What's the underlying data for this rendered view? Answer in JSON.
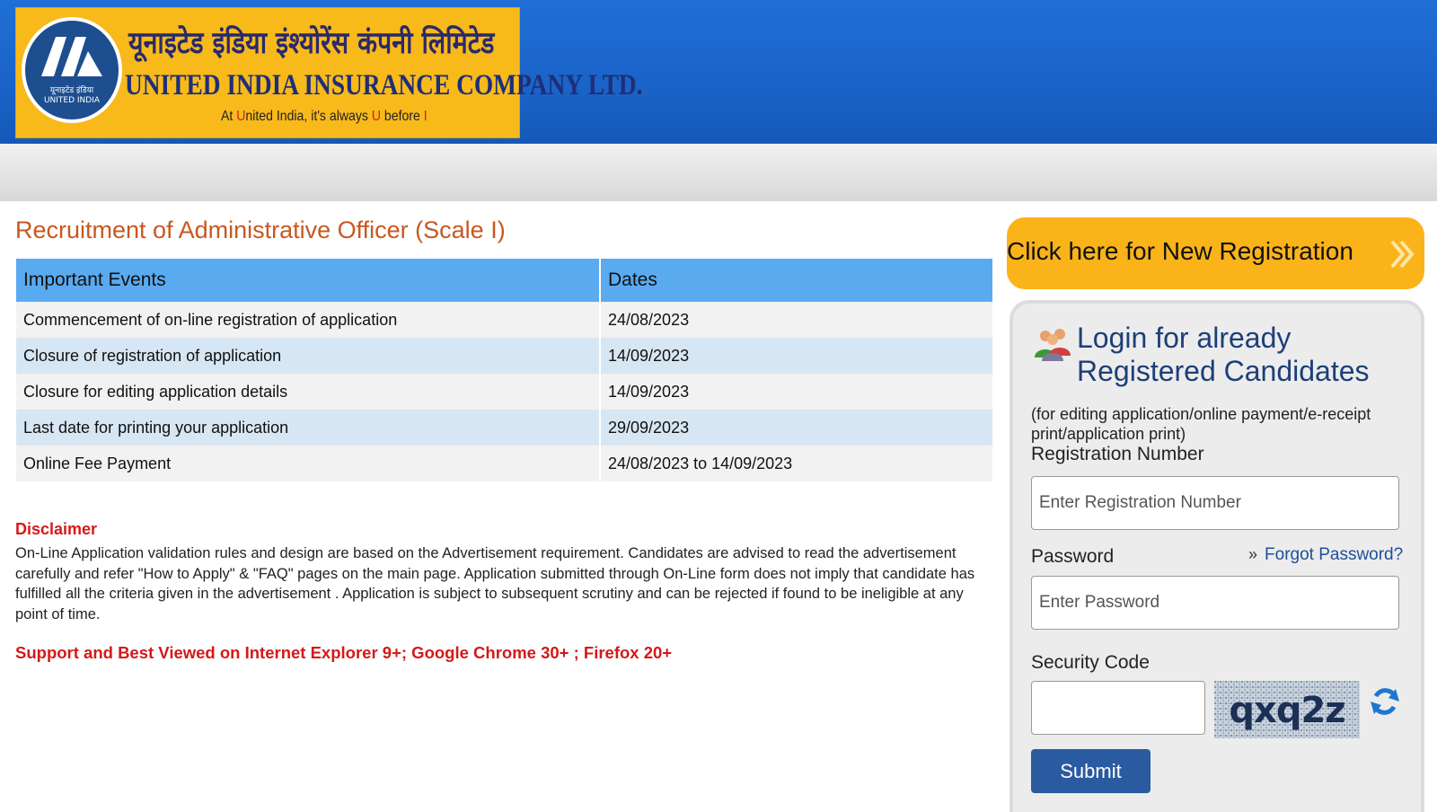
{
  "header": {
    "hindi_name": "यूनाइटेड इंडिया इंश्योरेंस कंपनी लिमिटेड",
    "english_name": "UNITED INDIA INSURANCE COMPANY LTD.",
    "tagline": {
      "part1": "At ",
      "part2": "U",
      "part3": "nited India, it's always ",
      "part4": "U",
      "part5": " before ",
      "part6": "I"
    },
    "logo_text_top": "यूनाइटेड इंडिया",
    "logo_text_bottom": "UNITED INDIA"
  },
  "page_title": "Recruitment of Administrative Officer (Scale I)",
  "events_table": {
    "headers": [
      "Important Events",
      "Dates"
    ],
    "rows": [
      [
        "Commencement of on-line registration of application",
        "24/08/2023"
      ],
      [
        "Closure of registration of application",
        "14/09/2023"
      ],
      [
        "Closure for editing application details",
        "14/09/2023"
      ],
      [
        "Last date for printing your application",
        "29/09/2023"
      ],
      [
        "Online Fee Payment",
        "24/08/2023 to 14/09/2023"
      ]
    ]
  },
  "disclaimer": {
    "title": "Disclaimer",
    "body": "On-Line Application validation rules and design are based on the Advertisement requirement. Candidates are advised to read the advertisement carefully and refer \"How to Apply\" & \"FAQ\" pages on the main page. Application submitted through On-Line form does not imply that candidate has fulfilled all the criteria given in the advertisement . Application is subject to subsequent scrutiny and can be rejected if found to be ineligible at any point of time."
  },
  "support_text": "Support and Best Viewed on Internet Explorer 9+; Google Chrome 30+ ; Firefox 20+",
  "new_registration": {
    "label": "Click here for New Registration",
    "arrow_icon": "double-chevron-right-icon"
  },
  "login": {
    "heading_line1": "Login for already",
    "heading_line2": "Registered Candidates",
    "note": "(for editing application/online payment/e-receipt print/application print)",
    "registration_label": "Registration Number",
    "registration_placeholder": "Enter Registration Number",
    "password_label": "Password",
    "password_placeholder": "Enter Password",
    "forgot_password": "Forgot Password?",
    "security_code_label": "Security Code",
    "security_code_value": "",
    "captcha_text": "qxq2z",
    "submit_label": "Submit"
  },
  "colors": {
    "header_blue": "#1a63c8",
    "logo_yellow": "#f8b91b",
    "title_orange": "#c8581f",
    "table_header_blue": "#5aaaf0",
    "row_alt_blue": "#d7e6f3",
    "disclaimer_red": "#d41919",
    "register_button_orange": "#fbb31a",
    "submit_blue": "#2a5ba0"
  }
}
